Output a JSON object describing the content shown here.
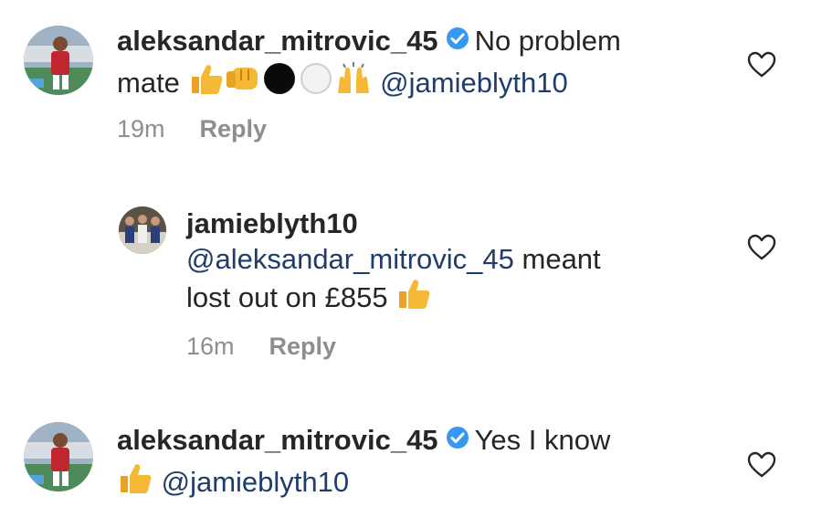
{
  "comments": [
    {
      "username": "aleksandar_mitrovic_45",
      "verified": true,
      "text": "No problem",
      "text_line2": "mate",
      "emojis": [
        "thumbs-up",
        "fist-bump",
        "black-circle",
        "white-circle",
        "raising-hands"
      ],
      "mention": "@jamieblyth10",
      "time": "19m",
      "reply_label": "Reply"
    },
    {
      "username": "jamieblyth10",
      "verified": false,
      "mention": "@aleksandar_mitrovic_45",
      "text": "meant",
      "text_line2": "lost out on £855",
      "emojis": [
        "thumbs-up"
      ],
      "time": "16m",
      "reply_label": "Reply"
    },
    {
      "username": "aleksandar_mitrovic_45",
      "verified": true,
      "text": "Yes I know",
      "emojis": [
        "thumbs-up"
      ],
      "mention": "@jamieblyth10"
    }
  ],
  "icons": {
    "heart": "heart-icon",
    "verified": "verified-badge-icon"
  },
  "colors": {
    "text": "#262626",
    "secondary": "#8e8e8e",
    "mention": "#1f3d6b",
    "verified": "#3897f0"
  }
}
